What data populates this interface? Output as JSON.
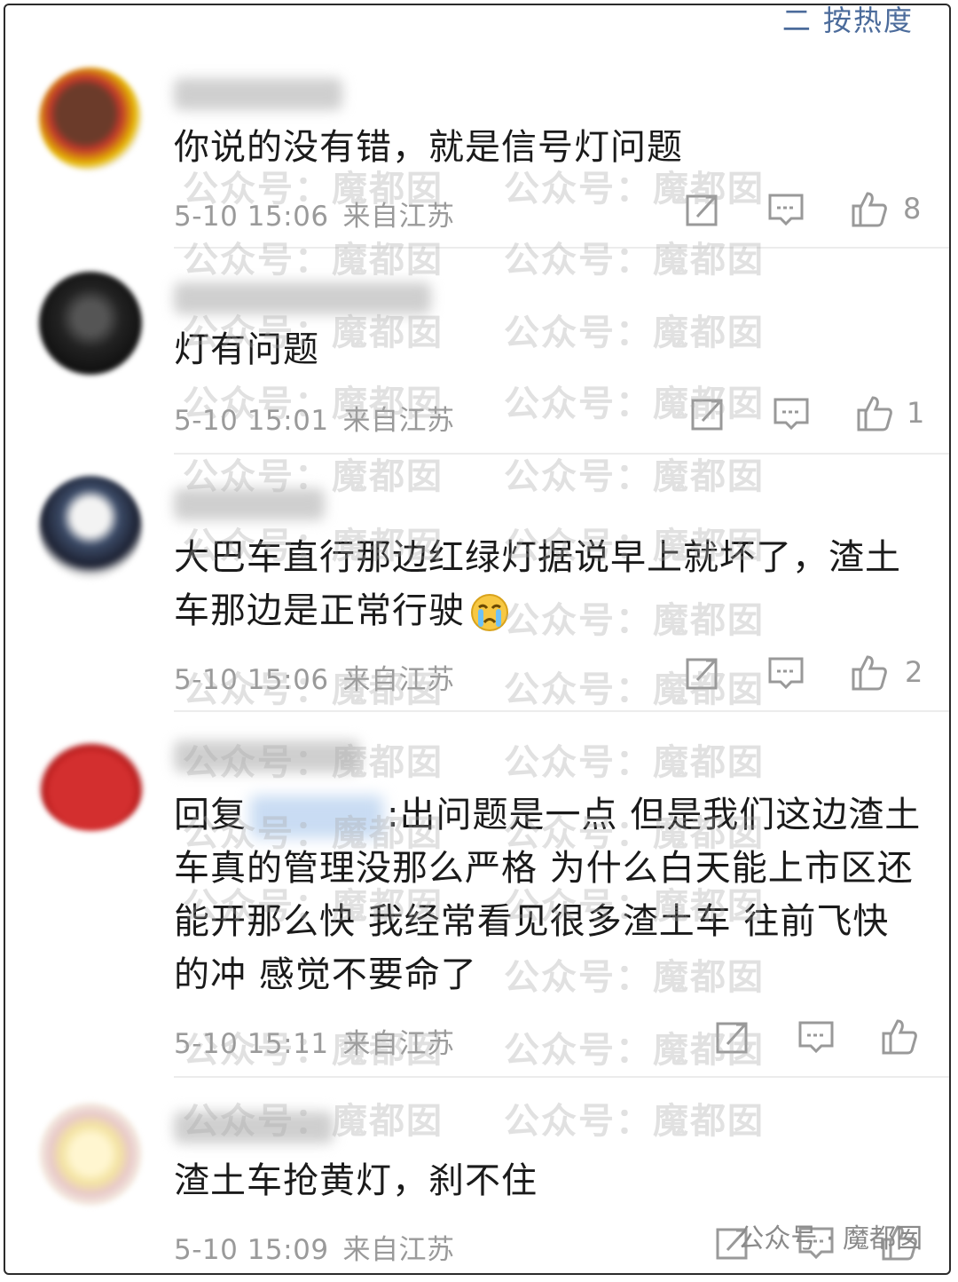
{
  "header": {
    "sort_label": "二 按热度"
  },
  "watermark_text": "公众号：魔都囡",
  "comments": [
    {
      "text": "你说的没有错，就是信号灯问题",
      "time": "5-10 15:06",
      "location": "来自江苏",
      "likes": "8"
    },
    {
      "text": "灯有问题",
      "time": "5-10 15:01",
      "location": "来自江苏",
      "likes": "1"
    },
    {
      "text_line1": "大巴车直行那边红绿灯据说早上就坏了，渣土",
      "text_line2": "车那边是正常行驶",
      "time": "5-10 15:06",
      "location": "来自江苏",
      "likes": "2",
      "emoji": "crying-face-icon"
    },
    {
      "reply_prefix": "回复",
      "reply_body_line1": ":出问题是一点 但是我们这边渣土",
      "text_line2": "车真的管理没那么严格 为什么白天能上市区还",
      "text_line3": "能开那么快 我经常看见很多渣土车 往前飞快",
      "text_line4": "的冲 感觉不要命了",
      "time": "5-10 15:11",
      "location": "来自江苏",
      "likes": ""
    },
    {
      "text": "渣土车抢黄灯，刹不住",
      "time": "5-10 15:09",
      "location": "来自江苏",
      "likes": ""
    }
  ],
  "brand": {
    "text": "公众号 · 魔都囡"
  }
}
